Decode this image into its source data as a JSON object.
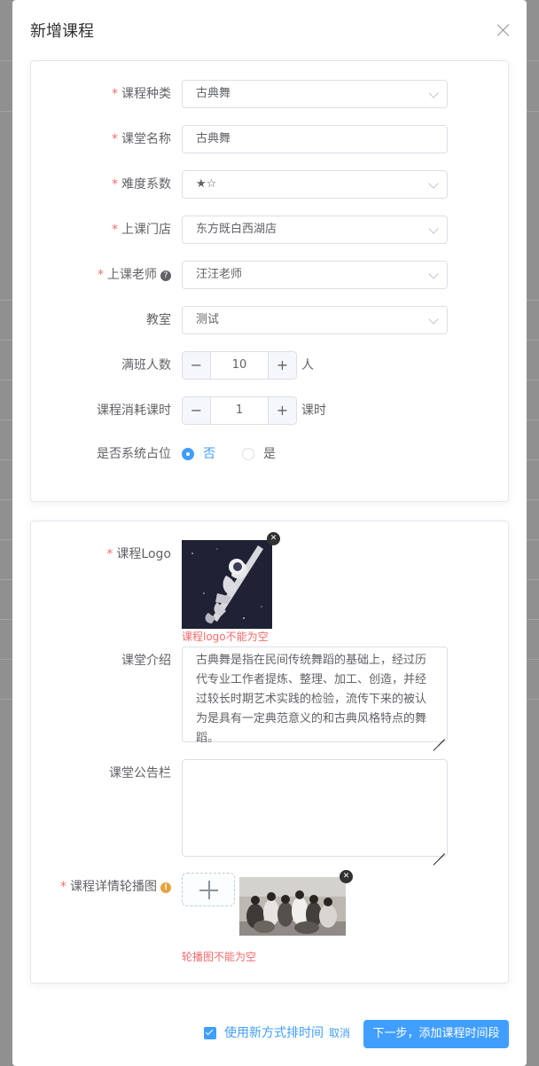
{
  "dialog": {
    "title": "新增课程"
  },
  "basic": {
    "course_type": {
      "label": "课程种类",
      "value": "古典舞"
    },
    "class_name": {
      "label": "课堂名称",
      "value": "古典舞"
    },
    "difficulty": {
      "label": "难度系数",
      "value": "★☆"
    },
    "store": {
      "label": "上课门店",
      "value": "东方既白西湖店"
    },
    "teacher": {
      "label": "上课老师",
      "value": "汪汪老师",
      "help_icon": "question-circle-icon"
    },
    "classroom": {
      "label": "教室",
      "value": "测试"
    },
    "capacity": {
      "label": "满班人数",
      "value": "10",
      "unit": "人",
      "minus": "−",
      "plus": "+"
    },
    "hours": {
      "label": "课程消耗课时",
      "value": "1",
      "unit": "课时",
      "minus": "−",
      "plus": "+"
    },
    "system_slot": {
      "label": "是否系统占位",
      "options": [
        "否",
        "是"
      ],
      "selected": "否"
    }
  },
  "media": {
    "logo": {
      "label": "课程Logo",
      "error": "课程logo不能为空",
      "remove_icon": "close-icon"
    },
    "intro": {
      "label": "课堂介绍",
      "value": "古典舞是指在民间传统舞蹈的基础上，经过历代专业工作者提炼、整理、加工、创造，并经过较长时期艺术实践的检验，流传下来的被认为是具有一定典范意义的和古典风格特点的舞蹈。"
    },
    "notice": {
      "label": "课堂公告栏",
      "value": ""
    },
    "carousel": {
      "label": "课程详情轮播图",
      "error": "轮播图不能为空",
      "warn_icon": "warning-icon",
      "upload_icon": "plus-icon"
    }
  },
  "footer": {
    "checkbox_label": "使用新方式排时间",
    "checked": true,
    "cancel": "取消",
    "next": "下一步，添加课程时间段"
  },
  "colors": {
    "primary": "#409eff",
    "danger": "#f56c6c",
    "warning": "#e6a23c"
  }
}
